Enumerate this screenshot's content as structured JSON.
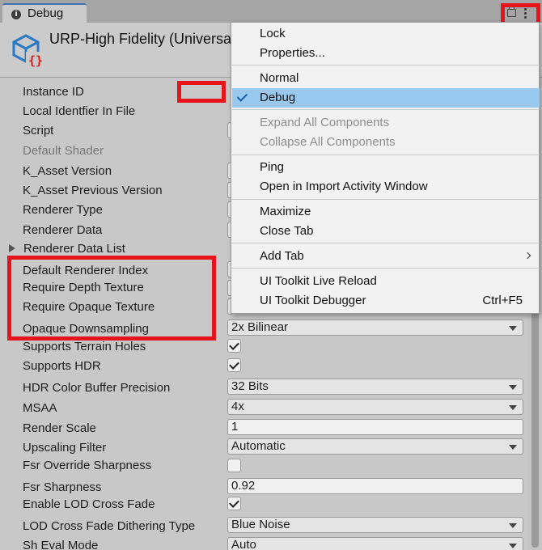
{
  "tab": {
    "label": "Debug"
  },
  "header": {
    "title": "URP-High Fidelity (Universal"
  },
  "properties": [
    {
      "label": "Instance ID"
    },
    {
      "label": "Local Identfier In File"
    },
    {
      "label": "Script"
    },
    {
      "label": "Default Shader"
    },
    {
      "label": "K_Asset Version"
    },
    {
      "label": "K_Asset Previous Version"
    },
    {
      "label": "Renderer Type"
    },
    {
      "label": "Renderer Data"
    },
    {
      "label": "Renderer Data List"
    },
    {
      "label": "Default Renderer Index"
    },
    {
      "label": "Require Depth Texture"
    },
    {
      "label": "Require Opaque Texture"
    },
    {
      "label": "Opaque Downsampling",
      "value": "2x Bilinear"
    },
    {
      "label": "Supports Terrain Holes",
      "checked": true
    },
    {
      "label": "Supports HDR",
      "checked": true
    },
    {
      "label": "HDR Color Buffer Precision",
      "value": "32 Bits"
    },
    {
      "label": "MSAA",
      "value": "4x"
    },
    {
      "label": "Render Scale",
      "value": "1"
    },
    {
      "label": "Upscaling Filter",
      "value": "Automatic"
    },
    {
      "label": "Fsr Override Sharpness",
      "checked": false
    },
    {
      "label": "Fsr Sharpness",
      "value": "0.92"
    },
    {
      "label": "Enable LOD Cross Fade",
      "checked": true
    },
    {
      "label": "LOD Cross Fade Dithering Type",
      "value": "Blue Noise"
    },
    {
      "label": "Sh Eval Mode",
      "value": "Auto"
    }
  ],
  "menu": {
    "items": [
      {
        "label": "Lock"
      },
      {
        "label": "Properties..."
      },
      {
        "label": "Normal"
      },
      {
        "label": "Debug",
        "checked": true,
        "selected": true
      },
      {
        "label": "Expand All Components",
        "disabled": true
      },
      {
        "label": "Collapse All Components",
        "disabled": true
      },
      {
        "label": "Ping"
      },
      {
        "label": "Open in Import Activity Window"
      },
      {
        "label": "Maximize"
      },
      {
        "label": "Close Tab"
      },
      {
        "label": "Add Tab",
        "submenu": true
      },
      {
        "label": "UI Toolkit Live Reload"
      },
      {
        "label": "UI Toolkit Debugger",
        "shortcut": "Ctrl+F5"
      }
    ]
  },
  "colors": {
    "highlight": "#e8141c",
    "selection": "#99c9ef",
    "accent": "#3a72b0"
  }
}
